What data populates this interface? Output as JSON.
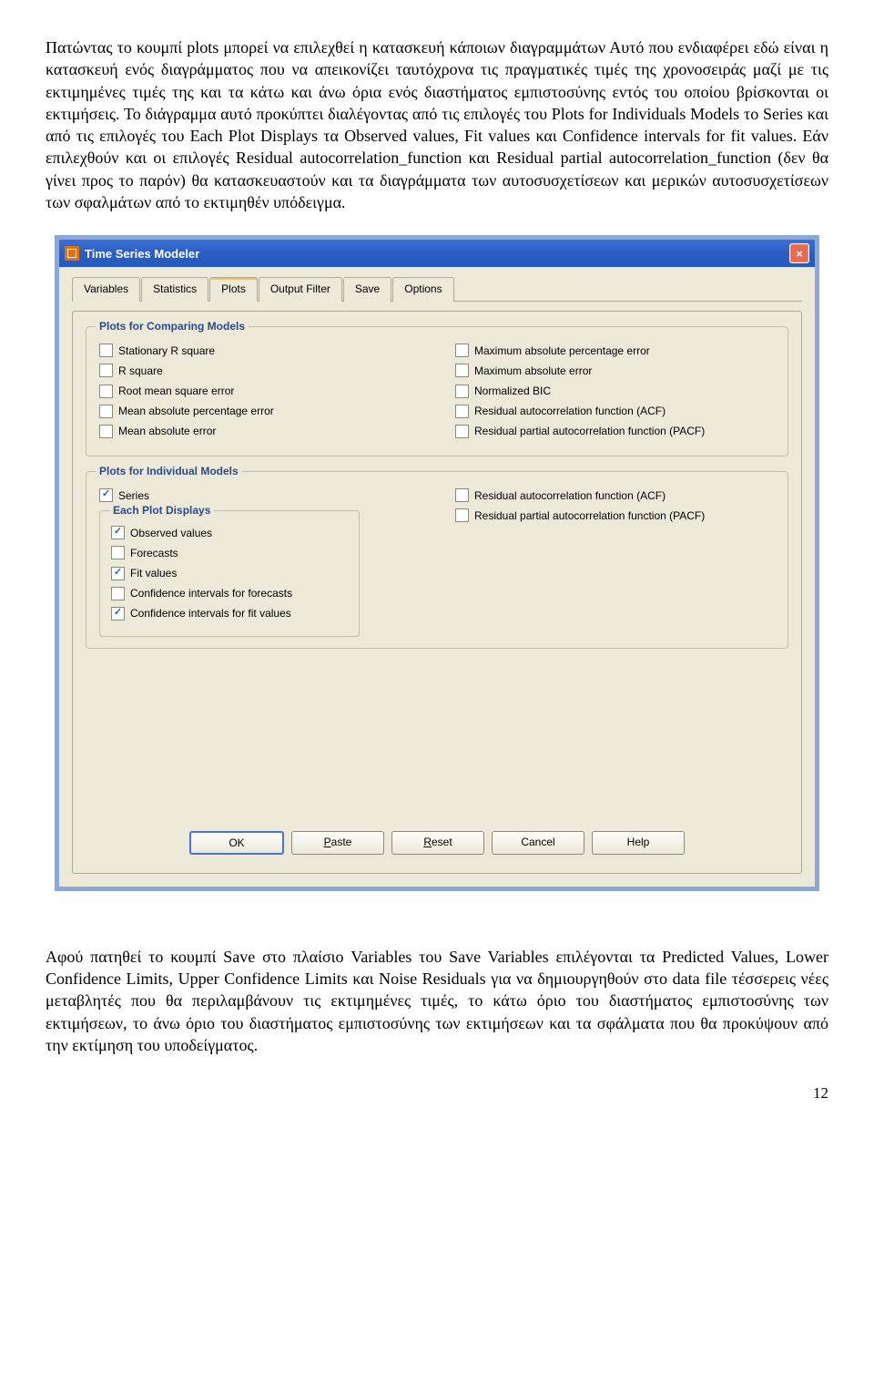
{
  "para1": "Πατώντας το κουμπί plots μπορεί να επιλεχθεί η κατασκευή κάποιων διαγραμμάτων Αυτό που ενδιαφέρει εδώ είναι η κατασκευή ενός διαγράμματος που να απεικονίζει ταυτόχρονα τις πραγματικές τιμές της χρονοσειράς μαζί με τις εκτιμημένες τιμές της και τα κάτω και άνω όρια ενός διαστήματος εμπιστοσύνης εντός του οποίου βρίσκονται οι εκτιμήσεις. Το διάγραμμα αυτό προκύπτει διαλέγοντας από τις επιλογές του Plots for Individuals Models το Series και από τις επιλογές του Each Plot Displays τα Observed values, Fit values και Confidence intervals for fit values. Εάν επιλεχθούν και οι επιλογές Residual autocorrelation_function και Residual partial autocorrelation_function (δεν θα γίνει προς το παρόν) θα κατασκευαστούν και τα διαγράμματα των αυτοσυσχετίσεων και μερικών αυτοσυσχετίσεων των σφαλμάτων από το εκτιμηθέν υπόδειγμα.",
  "dialog": {
    "title": "Time Series Modeler",
    "tabs": [
      "Variables",
      "Statistics",
      "Plots",
      "Output Filter",
      "Save",
      "Options"
    ],
    "activeTab": 2,
    "group1": {
      "title": "Plots for Comparing Models",
      "left": [
        {
          "label": "Stationary R square",
          "checked": false
        },
        {
          "label": "R square",
          "checked": false
        },
        {
          "label": "Root mean square error",
          "checked": false
        },
        {
          "label": "Mean absolute percentage error",
          "checked": false
        },
        {
          "label": "Mean absolute error",
          "checked": false
        }
      ],
      "right": [
        {
          "label": "Maximum absolute percentage error",
          "checked": false
        },
        {
          "label": "Maximum absolute error",
          "checked": false
        },
        {
          "label": "Normalized BIC",
          "checked": false
        },
        {
          "label": "Residual autocorrelation function (ACF)",
          "checked": false
        },
        {
          "label": "Residual partial autocorrelation function (PACF)",
          "checked": false
        }
      ]
    },
    "group2": {
      "title": "Plots for Individual Models",
      "series": {
        "label": "Series",
        "checked": true
      },
      "right": [
        {
          "label": "Residual autocorrelation function (ACF)",
          "checked": false
        },
        {
          "label": "Residual partial autocorrelation function (PACF)",
          "checked": false
        }
      ],
      "sub": {
        "title": "Each Plot Displays",
        "items": [
          {
            "label": "Observed values",
            "checked": true
          },
          {
            "label": "Forecasts",
            "checked": false
          },
          {
            "label": "Fit values",
            "checked": true
          },
          {
            "label": "Confidence intervals for forecasts",
            "checked": false
          },
          {
            "label": "Confidence intervals for fit values",
            "checked": true
          }
        ]
      }
    },
    "buttons": {
      "ok": "OK",
      "paste": "Paste",
      "reset": "Reset",
      "cancel": "Cancel",
      "help": "Help"
    }
  },
  "para2": "Αφού πατηθεί το κουμπί Save στο πλαίσιο Variables του Save Variables επιλέγονται τα Predicted Values, Lower Confidence Limits, Upper Confidence Limits και Noise Residuals για να δημιουργηθούν στο data file τέσσερεις νέες μεταβλητές που θα περιλαμβάνουν τις εκτιμημένες τιμές, το κάτω όριο του διαστήματος εμπιστοσύνης των εκτιμήσεων, το άνω όριο του διαστήματος εμπιστοσύνης των εκτιμήσεων και τα σφάλματα που θα προκύψουν από την εκτίμηση του υποδείγματος.",
  "pageNumber": "12"
}
